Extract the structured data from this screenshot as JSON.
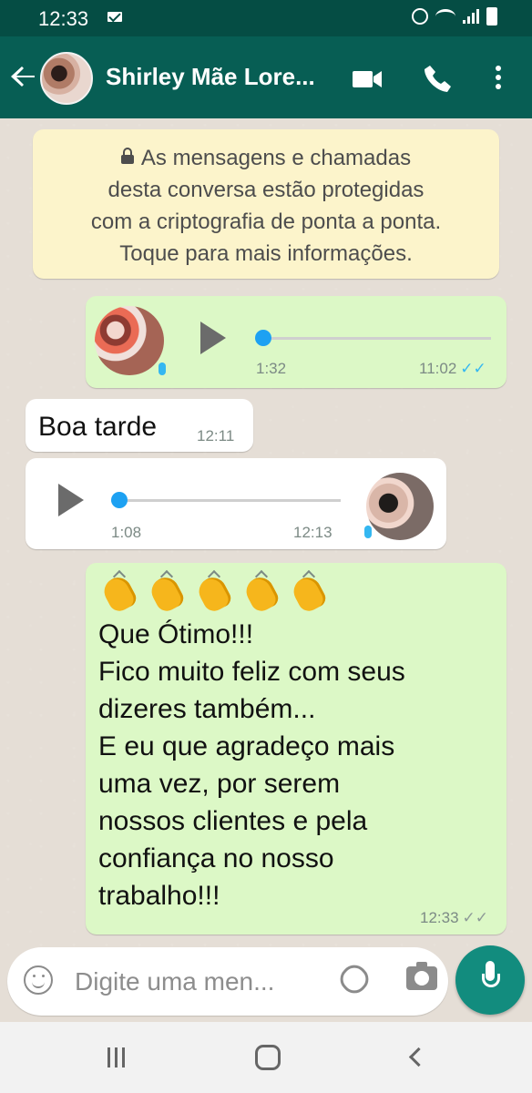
{
  "status_bar": {
    "time": "12:33"
  },
  "header": {
    "contact_name": "Shirley Mãe Lore...",
    "avatar_alt": "contact avatar"
  },
  "messages": {
    "encryption_note": "As mensagens e chamadas\ndesta conversa estão protegidas\ncom a criptografia de ponta a ponta.\nToque para mais informações.",
    "voice_1": {
      "duration": "1:32",
      "time": "11:02",
      "status": "✓✓",
      "progress": 0
    },
    "text_1": {
      "text": "Boa tarde",
      "time": "12:11"
    },
    "voice_2": {
      "duration": "1:08",
      "time": "12:13",
      "progress": 0
    },
    "text_2": {
      "emoji": "👏👏👏👏👏",
      "text": "Que Ótimo!!!\nFico muito feliz com seus\ndizeres também...\nE eu que agradeço mais\numa vez,  por serem\nnossos clientes e pela\nconfiança no nosso\ntrabalho!!!",
      "time": "12:33",
      "status": "✓✓"
    }
  },
  "composer": {
    "placeholder": "Digite uma men..."
  },
  "colors": {
    "header": "#075e54",
    "status": "#054d44",
    "sent_bubble": "#dcf8c6",
    "received_bubble": "#ffffff",
    "system_bubble": "#fcf4cb",
    "accent": "#34b7f1",
    "mic_button": "#128c7e"
  },
  "icons": {
    "mail": "mail-icon",
    "alarm": "alarm-icon",
    "wifi": "wifi-icon",
    "signal": "signal-icon",
    "battery": "battery-icon",
    "back": "back-arrow-icon",
    "video": "video-call-icon",
    "call": "phone-call-icon",
    "menu": "more-options-icon",
    "lock": "lock-icon",
    "play": "play-icon",
    "mic": "mic-icon",
    "emoji": "emoji-icon",
    "attach": "attach-icon",
    "camera": "camera-icon"
  }
}
